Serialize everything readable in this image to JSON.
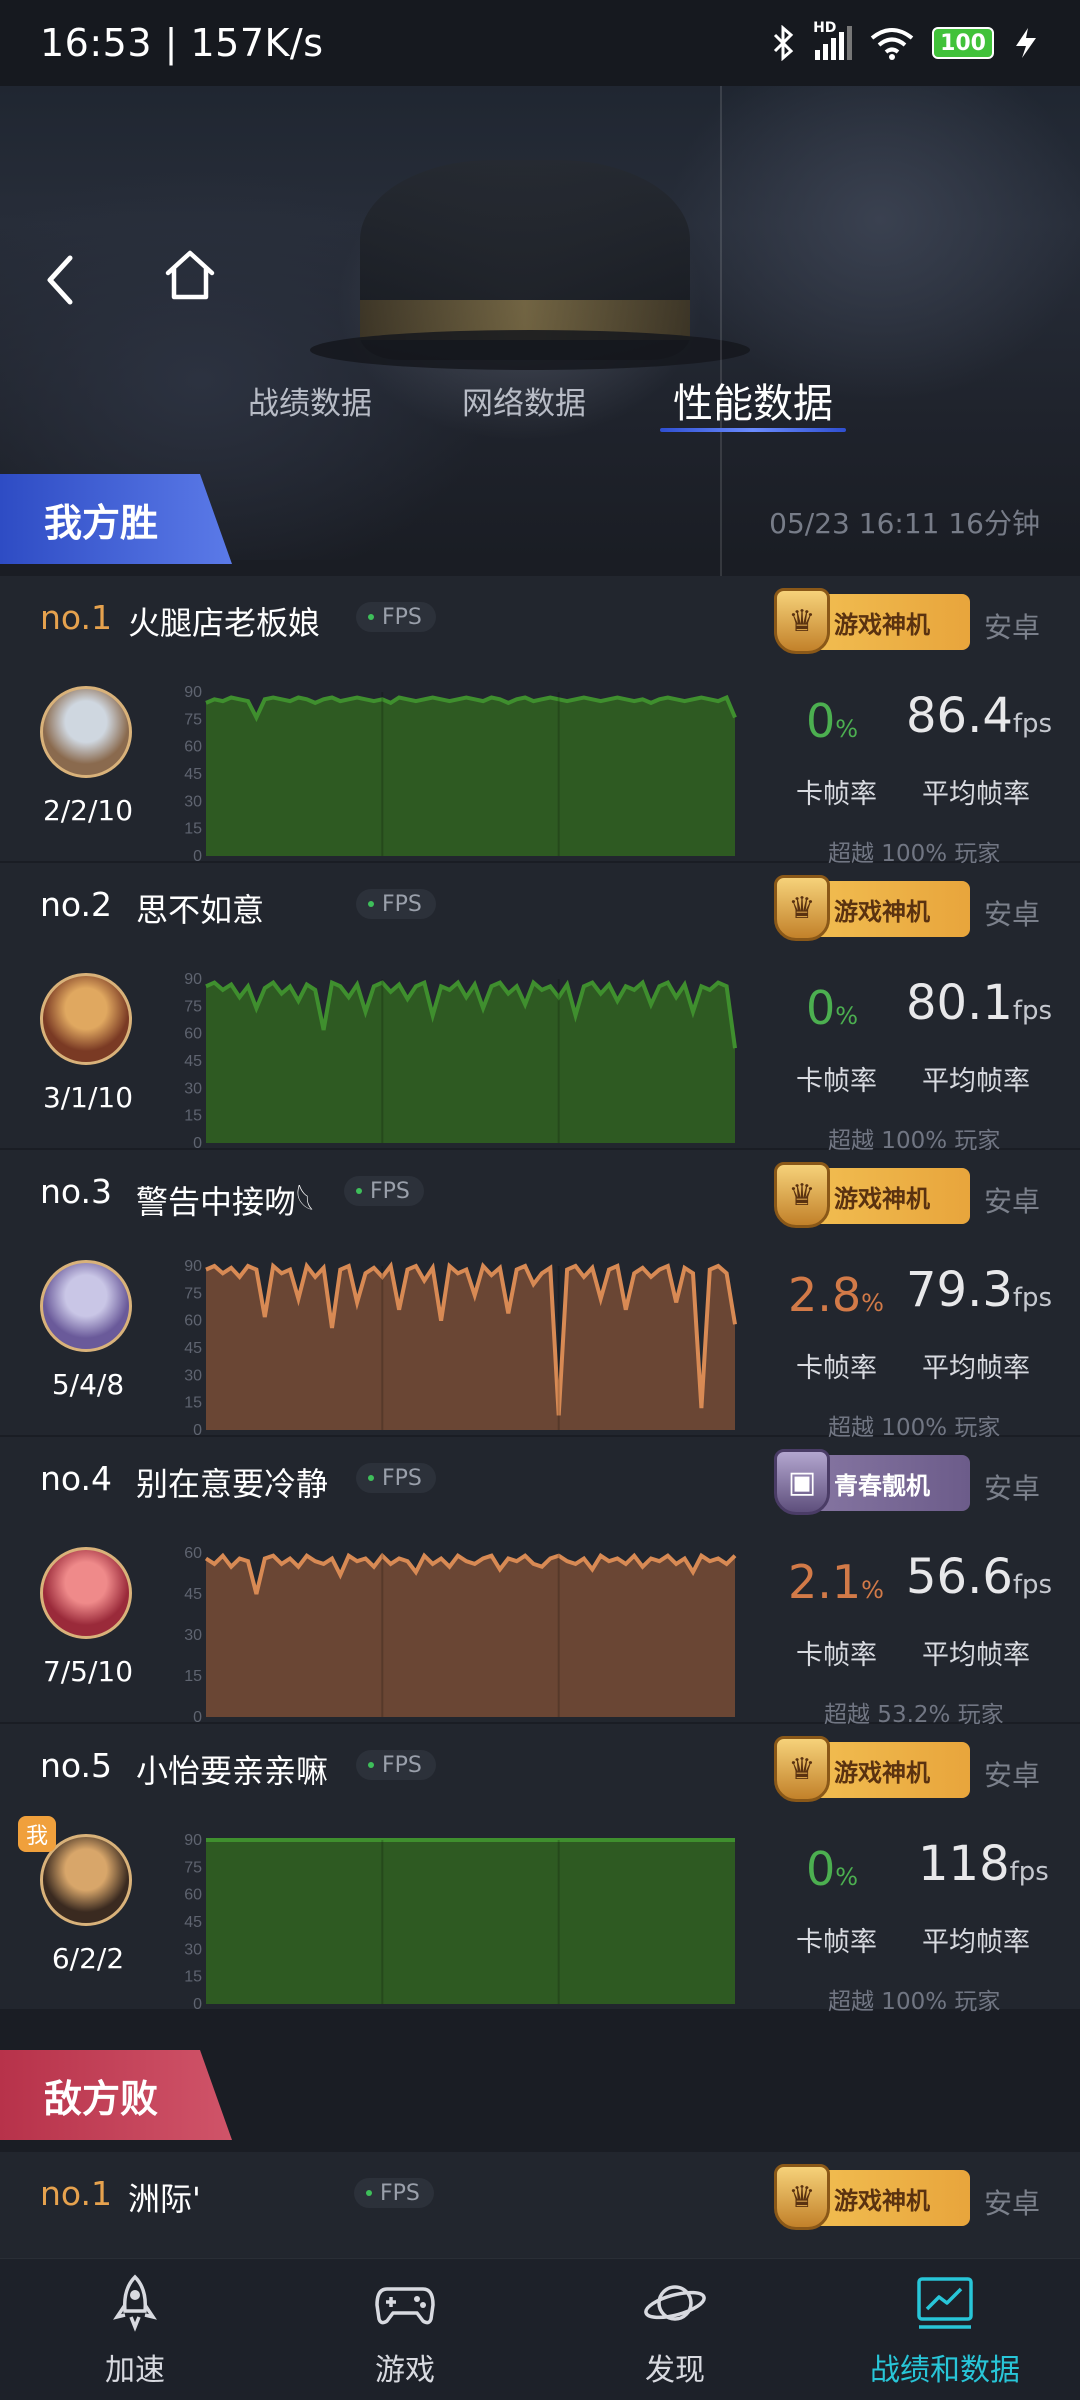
{
  "status": {
    "time_speed": "16:53 | 157K/s",
    "hd": "HD",
    "battery": "100"
  },
  "tabs": [
    {
      "label": "战绩数据",
      "active": false
    },
    {
      "label": "网络数据",
      "active": false
    },
    {
      "label": "性能数据",
      "active": true
    }
  ],
  "our_team": {
    "banner": "我方胜",
    "meta": "05/23 16:11   16分钟",
    "players": [
      {
        "no": "no.1",
        "name": "火腿店老板娘",
        "tag": "FPS",
        "badge": "游戏神机",
        "badge_type": "gold",
        "os": "安卓",
        "kda": "2/2/10",
        "stutter": "0",
        "stutter_color": "#4caf50",
        "fps": "86.4",
        "beat": "超越 100% 玩家",
        "me": false,
        "avatar_colors": [
          "#cfd7e0",
          "#8a6a4e"
        ],
        "chart_data": {
          "type": "area",
          "color": "#3f8f2e",
          "fill": "#2e5a22",
          "ylim": [
            0,
            90
          ],
          "yticks": [
            "90",
            "75",
            "60",
            "45",
            "30",
            "15",
            "0"
          ],
          "values": [
            84,
            86,
            85,
            87,
            86,
            85,
            76,
            86,
            87,
            86,
            85,
            87,
            86,
            84,
            86,
            87,
            85,
            86,
            87,
            86,
            85,
            86,
            84,
            87,
            86,
            85,
            86,
            87,
            86,
            85,
            86,
            87,
            86,
            85,
            87,
            86,
            84,
            86,
            87,
            85,
            86,
            87,
            86,
            85,
            86,
            87,
            86,
            85,
            86,
            87,
            86,
            85,
            86,
            84,
            86,
            87,
            86,
            85,
            86,
            87,
            86,
            85,
            87,
            76
          ]
        }
      },
      {
        "no": "no.2",
        "name": "思不如意",
        "tag": "FPS",
        "badge": "游戏神机",
        "badge_type": "gold",
        "os": "安卓",
        "kda": "3/1/10",
        "stutter": "0",
        "stutter_color": "#4caf50",
        "fps": "80.1",
        "beat": "超越 100% 玩家",
        "me": false,
        "avatar_colors": [
          "#e0a860",
          "#7a3a24"
        ],
        "chart_data": {
          "type": "area",
          "color": "#3f8f2e",
          "fill": "#2e5a22",
          "ylim": [
            0,
            90
          ],
          "yticks": [
            "90",
            "75",
            "60",
            "45",
            "30",
            "15",
            "0"
          ],
          "values": [
            86,
            88,
            84,
            87,
            80,
            86,
            74,
            85,
            88,
            82,
            86,
            78,
            87,
            84,
            62,
            88,
            86,
            80,
            87,
            72,
            86,
            88,
            83,
            87,
            79,
            86,
            88,
            70,
            86,
            84,
            88,
            80,
            87,
            74,
            86,
            88,
            82,
            86,
            76,
            88,
            84,
            86,
            80,
            87,
            70,
            86,
            88,
            82,
            87,
            78,
            86,
            84,
            88,
            76,
            86,
            88,
            80,
            87,
            72,
            86,
            84,
            88,
            86,
            52
          ]
        }
      },
      {
        "no": "no.3",
        "name": "警告中接吻𓆩",
        "tag": "FPS",
        "badge": "游戏神机",
        "badge_type": "gold",
        "os": "安卓",
        "kda": "5/4/8",
        "stutter": "2.8",
        "stutter_color": "#d27a48",
        "fps": "79.3",
        "beat": "超越 100% 玩家",
        "me": false,
        "avatar_colors": [
          "#c9c6e6",
          "#6a5a9a"
        ],
        "chart_data": {
          "type": "area",
          "color": "#d88a54",
          "fill": "#6a4634",
          "ylim": [
            0,
            90
          ],
          "yticks": [
            "90",
            "75",
            "60",
            "45",
            "30",
            "15",
            "0"
          ],
          "values": [
            88,
            90,
            86,
            89,
            84,
            90,
            88,
            62,
            90,
            86,
            88,
            72,
            90,
            84,
            89,
            56,
            88,
            90,
            70,
            86,
            89,
            84,
            90,
            66,
            88,
            90,
            82,
            89,
            60,
            90,
            86,
            88,
            74,
            90,
            85,
            89,
            64,
            88,
            90,
            80,
            86,
            89,
            8,
            88,
            90,
            84,
            89,
            72,
            88,
            90,
            66,
            86,
            89,
            84,
            88,
            90,
            70,
            89,
            86,
            12,
            88,
            90,
            86,
            58
          ]
        }
      },
      {
        "no": "no.4",
        "name": "别在意要冷静",
        "tag": "FPS",
        "badge": "青春靓机",
        "badge_type": "purple",
        "os": "安卓",
        "kda": "7/5/10",
        "stutter": "2.1",
        "stutter_color": "#d27a48",
        "fps": "56.6",
        "beat": "超越 53.2% 玩家",
        "me": false,
        "avatar_colors": [
          "#ef8a8a",
          "#9a2a3a"
        ],
        "chart_data": {
          "type": "area",
          "color": "#d88a54",
          "fill": "#6a4634",
          "ylim": [
            0,
            60
          ],
          "yticks": [
            "60",
            "45",
            "30",
            "15",
            "0"
          ],
          "values": [
            58,
            56,
            59,
            55,
            58,
            57,
            45,
            58,
            59,
            56,
            58,
            55,
            59,
            57,
            56,
            58,
            52,
            59,
            57,
            58,
            55,
            59,
            56,
            58,
            57,
            53,
            59,
            56,
            58,
            55,
            59,
            57,
            56,
            58,
            59,
            54,
            58,
            57,
            59,
            56,
            55,
            58,
            59,
            57,
            56,
            58,
            54,
            59,
            57,
            58,
            56,
            59,
            55,
            58,
            57,
            59,
            56,
            58,
            53,
            59,
            57,
            58,
            56,
            59
          ]
        }
      },
      {
        "no": "no.5",
        "name": "小怡要亲亲嘛",
        "tag": "FPS",
        "badge": "游戏神机",
        "badge_type": "gold",
        "os": "安卓",
        "kda": "6/2/2",
        "stutter": "0",
        "stutter_color": "#4caf50",
        "fps": "118",
        "beat": "超越 100% 玩家",
        "me": true,
        "me_label": "我",
        "avatar_colors": [
          "#d8a66a",
          "#3a2a20"
        ],
        "chart_data": {
          "type": "area",
          "color": "#3f8f2e",
          "fill": "#2e5a22",
          "ylim": [
            0,
            90
          ],
          "yticks": [
            "90",
            "75",
            "60",
            "45",
            "30",
            "15",
            "0"
          ],
          "values": [
            90,
            90,
            90,
            90,
            90,
            90,
            90,
            90,
            90,
            90,
            90,
            90,
            90,
            90,
            90,
            90,
            90,
            90,
            90,
            90,
            90,
            90,
            90,
            90,
            90,
            90,
            90,
            90,
            90,
            90,
            90,
            90
          ]
        }
      }
    ],
    "stutter_label": "卡帧率",
    "fps_label": "平均帧率",
    "fps_unit": "fps",
    "pct_unit": "%"
  },
  "enemy_team": {
    "banner": "敌方败",
    "players": [
      {
        "no": "no.1",
        "name": "洲际'",
        "tag": "FPS",
        "badge": "游戏神机",
        "badge_type": "gold",
        "os": "安卓"
      }
    ]
  },
  "bottom_nav": [
    {
      "label": "加速",
      "icon": "rocket-icon",
      "active": false
    },
    {
      "label": "游戏",
      "icon": "gamepad-icon",
      "active": false
    },
    {
      "label": "发现",
      "icon": "planet-icon",
      "active": false
    },
    {
      "label": "战绩和数据",
      "icon": "chart-icon",
      "active": true
    }
  ]
}
